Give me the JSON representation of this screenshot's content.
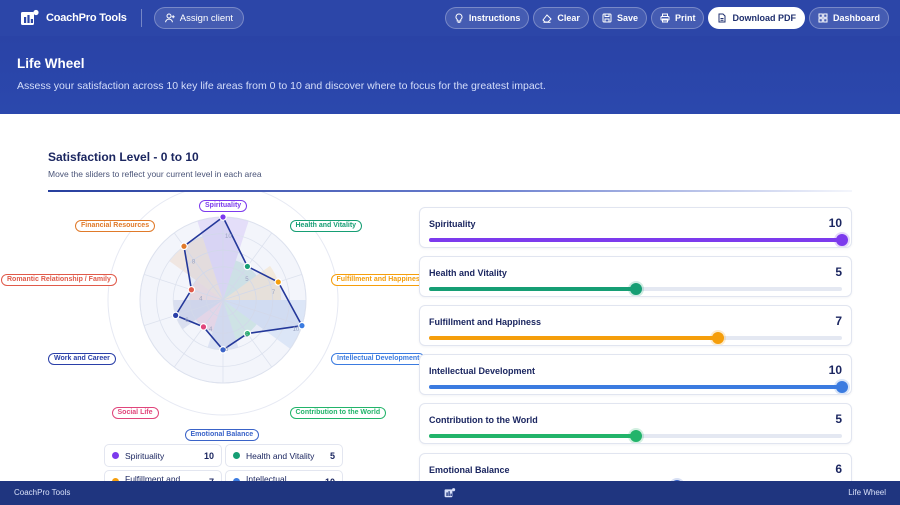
{
  "app": {
    "name": "CoachPro Tools",
    "assign_label": "Assign client"
  },
  "toolbar": {
    "instructions": "Instructions",
    "clear": "Clear",
    "save": "Save",
    "print": "Print",
    "download": "Download PDF",
    "dashboard": "Dashboard"
  },
  "hero": {
    "title": "Life Wheel",
    "subtitle": "Assess your satisfaction across 10 key life areas from 0 to 10 and discover where to focus for the greatest impact."
  },
  "section": {
    "title": "Satisfaction Level - 0 to 10",
    "subtitle": "Move the sliders to reflect your current level in each area"
  },
  "max_value": 10,
  "areas": [
    {
      "name": "Spirituality",
      "value": 10,
      "color": "#7c3aed"
    },
    {
      "name": "Health and Vitality",
      "value": 5,
      "color": "#169e74"
    },
    {
      "name": "Fulfillment and Happiness",
      "value": 7,
      "color": "#f59e0b"
    },
    {
      "name": "Intellectual Development",
      "value": 10,
      "color": "#3b7be0"
    },
    {
      "name": "Contribution to the World",
      "value": 5,
      "color": "#22b46a"
    },
    {
      "name": "Emotional Balance",
      "value": 6,
      "color": "#3a63c8"
    },
    {
      "name": "Social Life",
      "value": 4,
      "color": "#e0457b"
    },
    {
      "name": "Work and Career",
      "value": 6,
      "color": "#2a3fa8"
    },
    {
      "name": "Romantic Relationship / Family",
      "value": 4,
      "color": "#e05a4a"
    },
    {
      "name": "Financial Resources",
      "value": 8,
      "color": "#e07a2a"
    }
  ],
  "legend": [
    {
      "name": "Spirituality",
      "value": "10",
      "color": "#7c3aed"
    },
    {
      "name": "Health and Vitality",
      "value": "5",
      "color": "#169e74"
    },
    {
      "name": "Fulfillment and Happiness",
      "value": "7",
      "color": "#f59e0b"
    },
    {
      "name": "Intellectual Development",
      "value": "10",
      "color": "#3b7be0"
    }
  ],
  "footer": {
    "left": "CoachPro Tools",
    "right": "Life Wheel"
  }
}
